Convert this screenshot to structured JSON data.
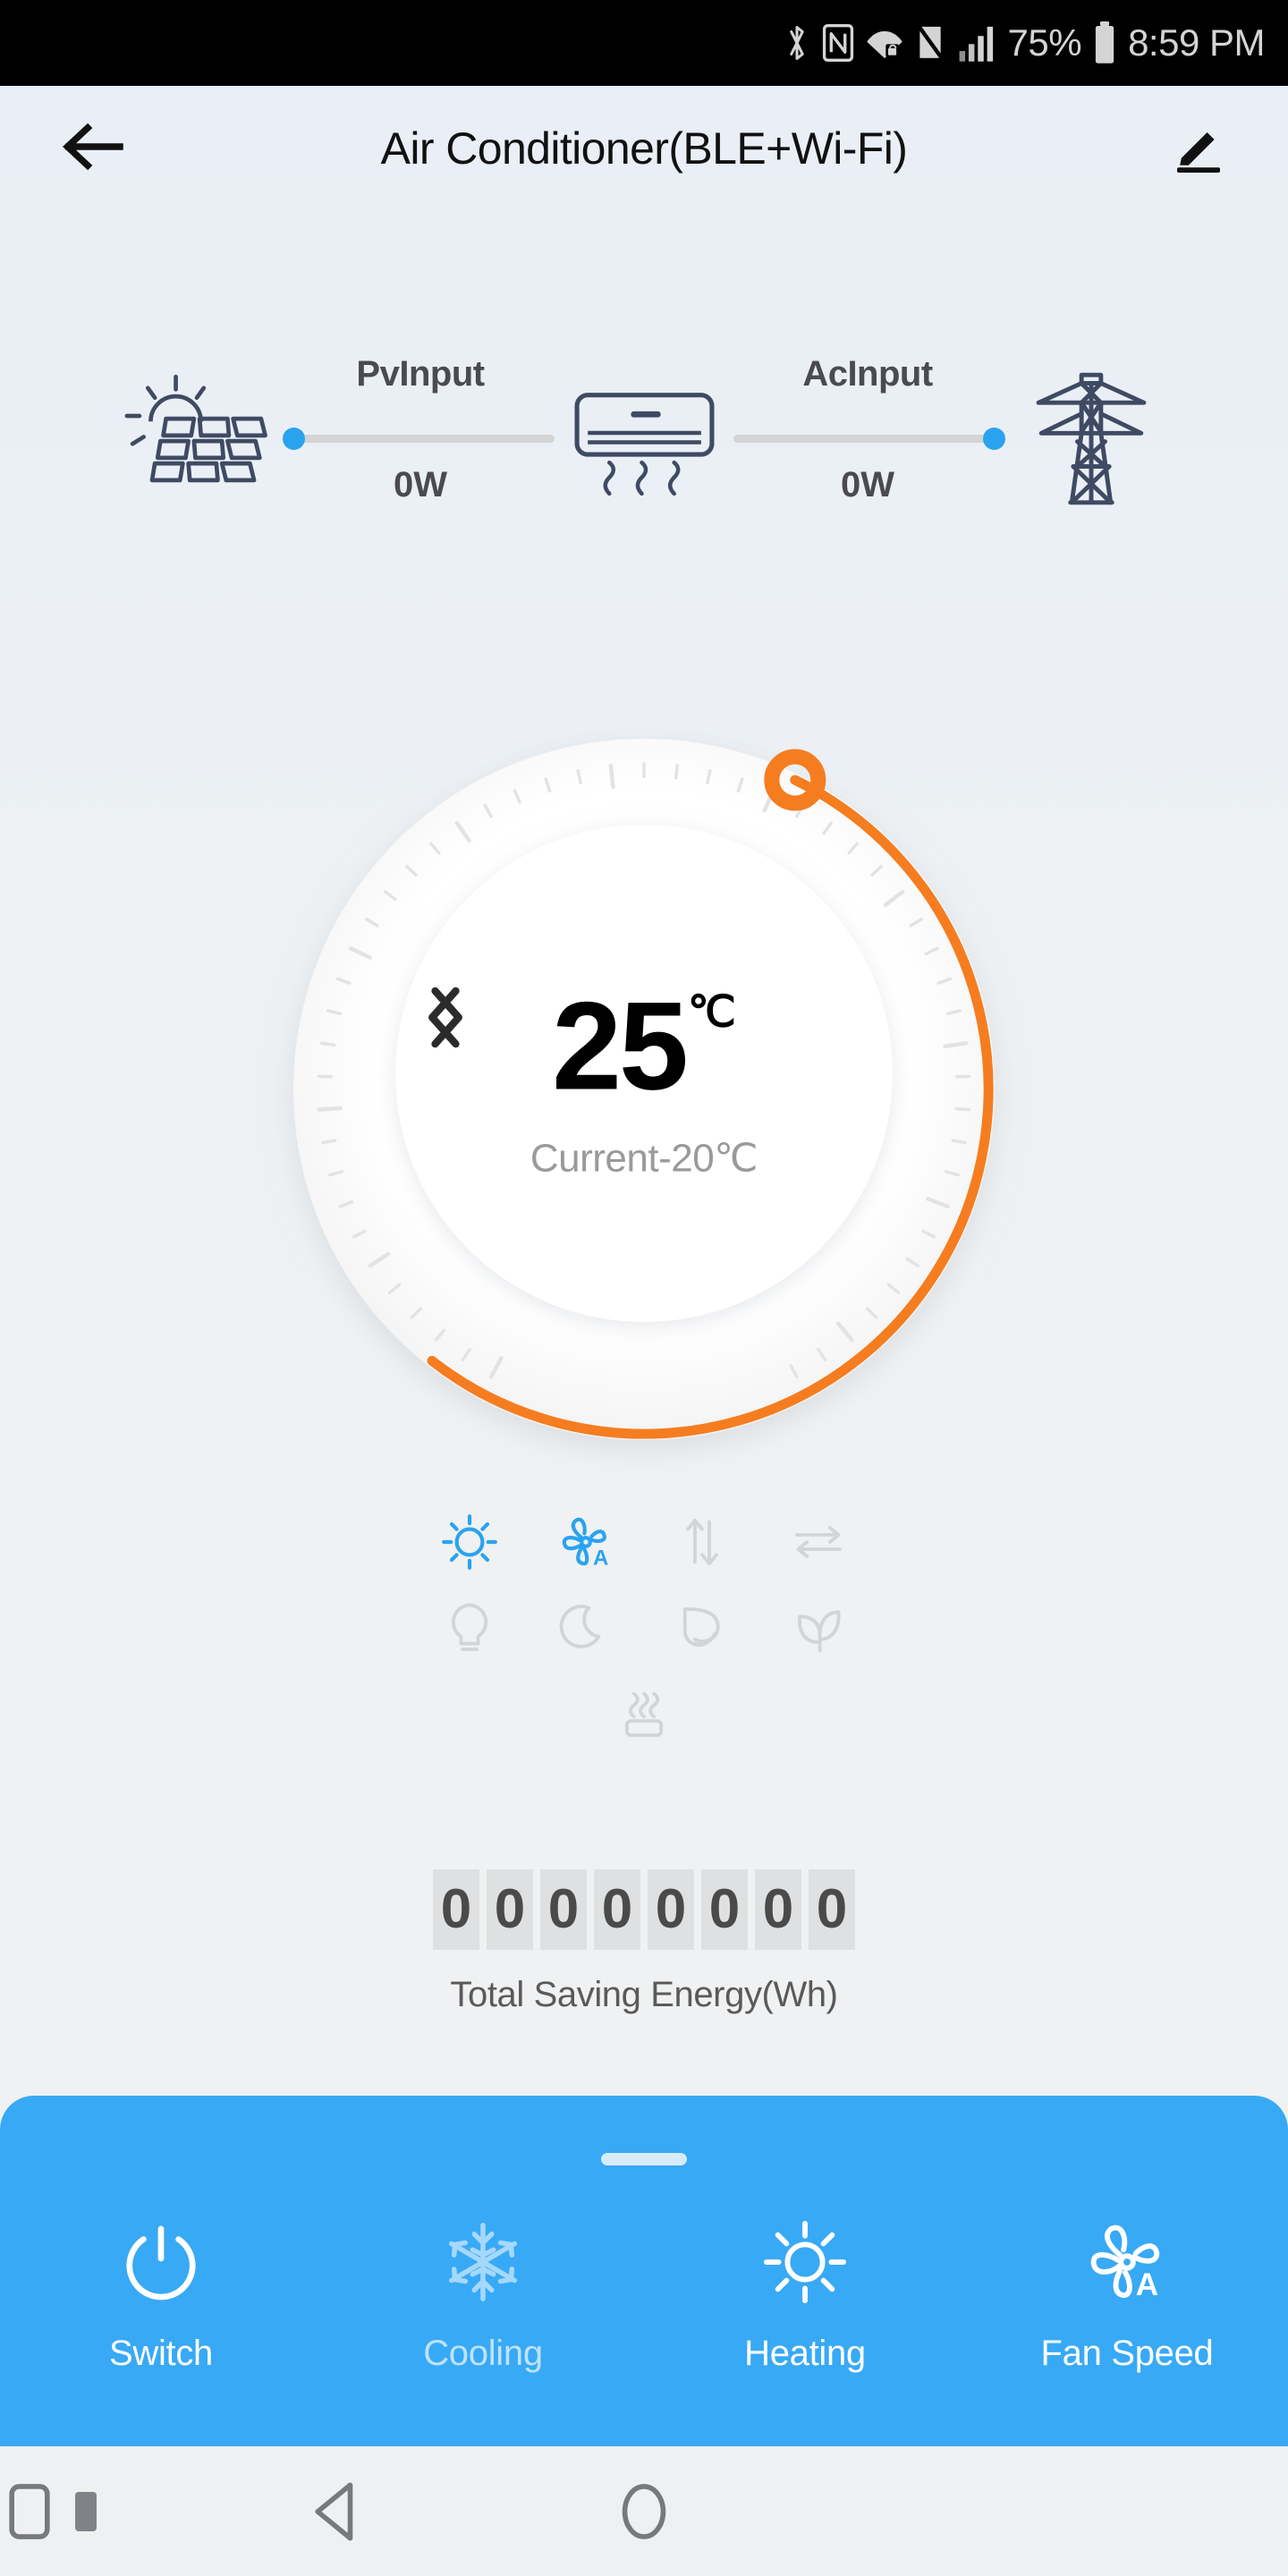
{
  "status_bar": {
    "icons": [
      "bluetooth-icon",
      "nfc-icon",
      "wifi-lock-icon",
      "no-sim-icon",
      "cellular-signal-icon"
    ],
    "battery_percent": "75%",
    "time": "8:59 PM"
  },
  "app_bar": {
    "back_icon": "back-arrow-icon",
    "title": "Air Conditioner(BLE+Wi-Fi)",
    "edit_icon": "edit-pencil-icon"
  },
  "energy_flow": {
    "source_icon": "solar-panel-icon",
    "device_icon": "air-conditioner-icon",
    "grid_icon": "power-tower-icon",
    "links": [
      {
        "label": "PvInput",
        "value": "0W",
        "dot_side": "left"
      },
      {
        "label": "AcInput",
        "value": "0W",
        "dot_side": "right"
      }
    ]
  },
  "dial": {
    "target_temp": "25",
    "unit": "℃",
    "current_label": "Current-20℃",
    "decrease_icon": "chevron-left-icon",
    "increase_icon": "chevron-right-icon",
    "arc_color": "#f57d20",
    "arc_start_deg": 210,
    "arc_end_deg": 65,
    "handle_icon": "dial-handle-icon",
    "min_temp": 16,
    "max_temp": 30
  },
  "status_icons": {
    "active_color": "#29a3ef",
    "inactive_color": "#d2d4d6",
    "rows": [
      [
        {
          "name": "sun-heating-icon",
          "active": true
        },
        {
          "name": "fan-auto-icon",
          "active": true
        },
        {
          "name": "vertical-swing-icon",
          "active": false
        },
        {
          "name": "horizontal-swing-icon",
          "active": false
        }
      ],
      [
        {
          "name": "light-bulb-icon",
          "active": false
        },
        {
          "name": "sleep-moon-icon",
          "active": false
        },
        {
          "name": "self-clean-icon",
          "active": false
        },
        {
          "name": "eco-leaves-icon",
          "active": false
        }
      ],
      [
        {
          "name": "dry-heat-icon",
          "active": false
        }
      ]
    ]
  },
  "energy_counter": {
    "digits": [
      "0",
      "0",
      "0",
      "0",
      "0",
      "0",
      "0",
      "0"
    ],
    "label": "Total Saving Energy(Wh)"
  },
  "bottom_panel": {
    "drag_handle": "drag-handle",
    "background_color": "#38a9f5",
    "actions": [
      {
        "label": "Switch",
        "icon": "power-icon",
        "dim": false
      },
      {
        "label": "Cooling",
        "icon": "snowflake-icon",
        "dim": true
      },
      {
        "label": "Heating",
        "icon": "sun-icon",
        "dim": false
      },
      {
        "label": "Fan Speed",
        "icon": "fan-auto-icon",
        "dim": false
      }
    ]
  },
  "nav_bar": {
    "items": [
      "nav-dot",
      "nav-back-icon",
      "nav-home-icon",
      "nav-recents-icon"
    ]
  }
}
